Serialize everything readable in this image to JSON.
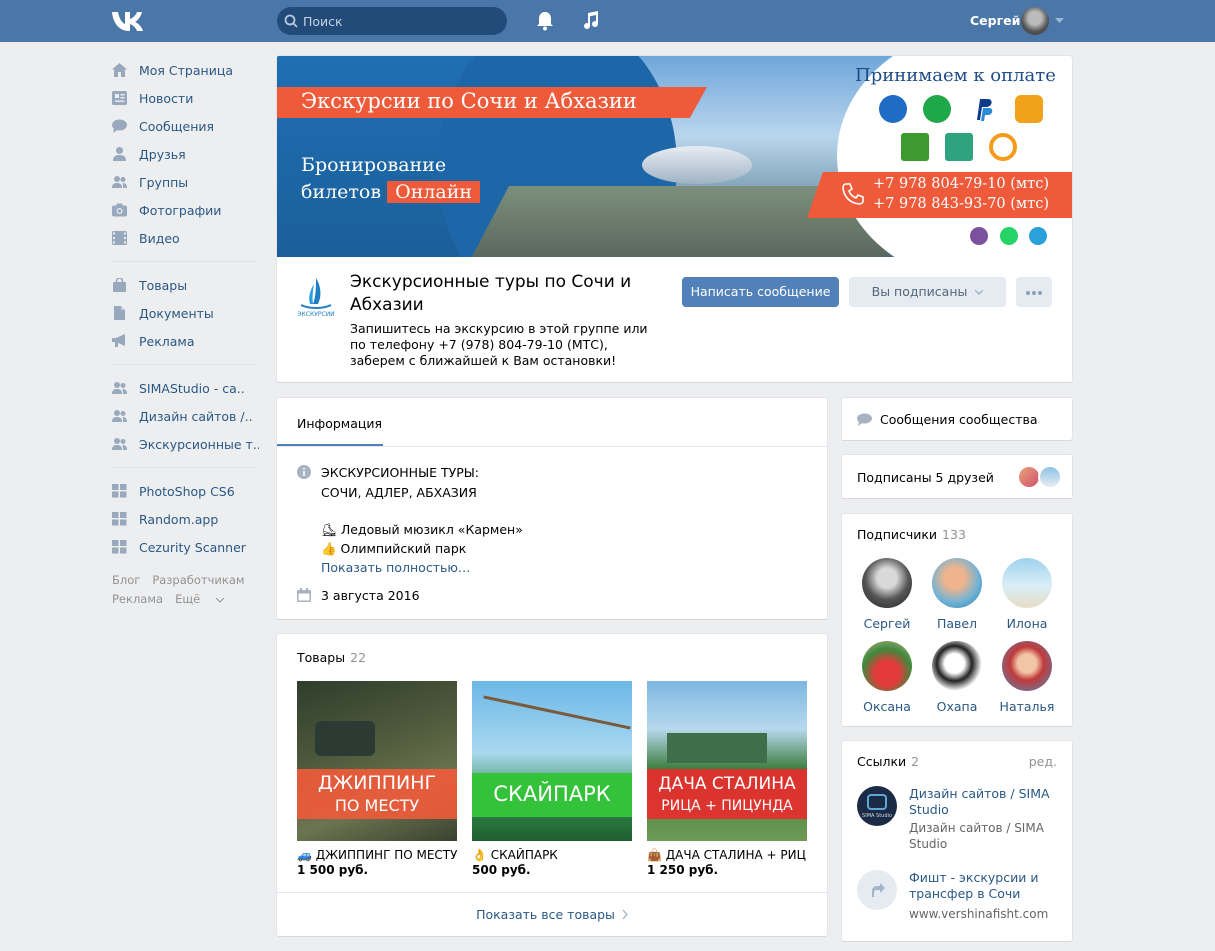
{
  "header": {
    "search_placeholder": "Поиск",
    "user_name": "Сергей"
  },
  "sidebar": {
    "main": [
      {
        "label": "Моя Страница",
        "icon": "home-icon"
      },
      {
        "label": "Новости",
        "icon": "news-icon"
      },
      {
        "label": "Сообщения",
        "icon": "messages-icon"
      },
      {
        "label": "Друзья",
        "icon": "friends-icon"
      },
      {
        "label": "Группы",
        "icon": "groups-icon"
      },
      {
        "label": "Фотографии",
        "icon": "camera-icon"
      },
      {
        "label": "Видео",
        "icon": "video-icon"
      }
    ],
    "secondary": [
      {
        "label": "Товары",
        "icon": "bag-icon"
      },
      {
        "label": "Документы",
        "icon": "document-icon"
      },
      {
        "label": "Реклама",
        "icon": "megaphone-icon"
      }
    ],
    "groups": [
      {
        "label": "SIMAStudio - са..",
        "icon": "groups-icon"
      },
      {
        "label": "Дизайн сайтов /..",
        "icon": "groups-icon"
      },
      {
        "label": "Экскурсионные т..",
        "icon": "groups-icon"
      }
    ],
    "apps": [
      {
        "label": "PhotoShop CS6",
        "icon": "app-icon"
      },
      {
        "label": "Random.app",
        "icon": "app-icon"
      },
      {
        "label": "Cezurity Scanner",
        "icon": "app-icon"
      }
    ],
    "footer": [
      "Блог",
      "Разработчикам",
      "Реклама",
      "Ещё"
    ]
  },
  "cover": {
    "banner": "Экскурсии по Сочи и Абхазии",
    "booking_line1": "Бронирование",
    "booking_line2": "билетов",
    "booking_online": "Онлайн",
    "accept": "Принимаем к оплате",
    "phone1": "+7 978 804-79-10 (мтс)",
    "phone2": "+7 978 843-93-70 (мтс)",
    "logo_text": "ЭКСКУРСИИ"
  },
  "group": {
    "title": "Экскурсионные туры по Сочи и Абхазии",
    "description": "Запишитесь на экскурсию в этой группе или по телефону +7 (978) 804-79-10 (МТС), заберем с ближайшей к Вам остановки!",
    "message_button": "Написать сообщение",
    "subscribed_button": "Вы подписаны"
  },
  "info": {
    "tab": "Информация",
    "line1": "ЭКСКУРСИОННЫЕ ТУРЫ:",
    "line2": "СОЧИ, АДЛЕР, АБХАЗИЯ",
    "line3": "⛸ Ледовый мюзикл «Кармен»",
    "line4": "👍 Олимпийский парк",
    "show_more": "Показать полностью…",
    "date": "3 августа 2016"
  },
  "goods": {
    "title": "Товары",
    "count": "22",
    "items": [
      {
        "caption1": "ДЖИППИНГ",
        "caption2": "ПО МЕСТУ",
        "name": "🚙 ДЖИППИНГ ПО МЕСТУ",
        "price": "1 500 руб."
      },
      {
        "caption1": "СКАЙПАРК",
        "caption2": "",
        "name": "👌 СКАЙПАРК",
        "price": "500 руб."
      },
      {
        "caption1": "ДАЧА СТАЛИНА",
        "caption2": "РИЦА + ПИЦУНДА",
        "name": "👜 ДАЧА СТАЛИНА + РИЦ..",
        "price": "1 250 руб."
      }
    ],
    "show_all": "Показать все товары"
  },
  "right": {
    "community_messages": "Сообщения сообщества",
    "friends_subscribed": "Подписаны 5 друзей",
    "subscribers_title": "Подписчики",
    "subscribers_count": "133",
    "subscribers": [
      "Сергей",
      "Павел",
      "Илона",
      "Оксана",
      "Охапа",
      "Наталья"
    ],
    "links_title": "Ссылки",
    "links_count": "2",
    "links_edit": "ред.",
    "links": [
      {
        "title": "Дизайн сайтов / SIMA Studio",
        "sub": "Дизайн сайтов / SIMA Studio",
        "avatar_text": "SIMA Studio"
      },
      {
        "title": "Фишт - экскурсии и трансфер в Сочи",
        "sub": "www.vershinafisht.com"
      }
    ]
  },
  "colors": {
    "header": "#4a76a8",
    "link": "#2a5885",
    "primary_button": "#5181b8",
    "banner_accent": "#ee5a3a"
  }
}
